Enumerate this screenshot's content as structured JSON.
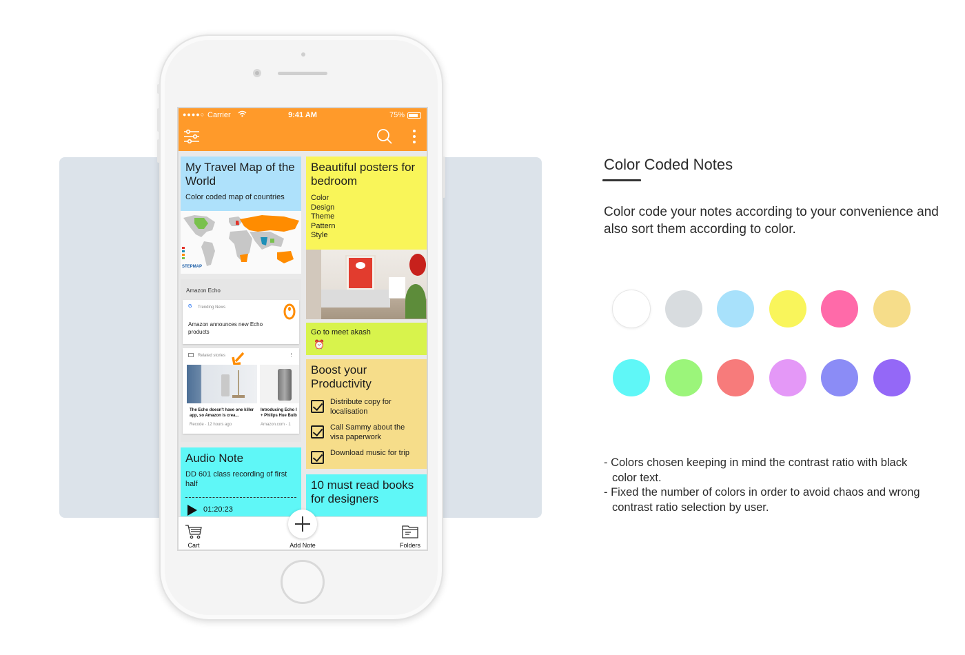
{
  "status_bar": {
    "signal": "●●●●○",
    "carrier": "Carrier",
    "time": "9:41 AM",
    "battery": "75%"
  },
  "app_bar": {
    "filter_icon": "filter-sliders-icon",
    "search_icon": "search-icon",
    "menu_icon": "more-vert-icon"
  },
  "notes": {
    "travel": {
      "title": "My Travel Map of the World",
      "text": "Color coded map of countries",
      "color": "#aee1fb"
    },
    "echo": {
      "label": "Amazon Echo",
      "card1_source": "Trending News",
      "card1_text": "Amazon announces new Echo products",
      "card2_source": "Related stories",
      "story1": "The Echo doesn't have one killer app, so Amazon is crea...",
      "story1_meta": "Recode · 12 hours ago",
      "story2": "Introducing Echo I + Philips Hue Bulb",
      "story2_meta": "Amazon.com · 1"
    },
    "audio": {
      "title": "Audio Note",
      "text": "DD 601 class recording of first half",
      "time": "01:20:23",
      "color": "#5ff7f7"
    },
    "posters": {
      "title": "Beautiful posters for bedroom",
      "items": [
        "Color",
        "Design",
        "Theme",
        "Pattern",
        "Style"
      ],
      "color": "#f9f559"
    },
    "meet": {
      "text": "Go to meet akash",
      "icon": "alarm-clock-icon",
      "color": "#d8f34c"
    },
    "boost": {
      "title": "Boost your Productivity",
      "tasks": [
        "Distribute copy for localisation",
        "Call Sammy about the visa paperwork",
        "Download music for trip"
      ],
      "color": "#f6dd8a"
    },
    "books": {
      "title": "10 must read books for designers",
      "color": "#5ff7f7"
    }
  },
  "tab_bar": {
    "cart": "Cart",
    "add_note": "Add Note",
    "folders": "Folders"
  },
  "info": {
    "heading": "Color Coded Notes",
    "description": "Color code your notes according to your convenience and also sort them according to color.",
    "bullets": [
      "- Colors chosen keeping in mind the contrast ratio with black color text.",
      "- Fixed the number of colors in order to avoid chaos and wrong contrast ratio selection by user."
    ]
  },
  "palette": [
    "#ffffff",
    "#d8dcdf",
    "#a8e1fb",
    "#f9f55b",
    "#ff6aa9",
    "#f6dd8a",
    "#5ff7f7",
    "#9bf57a",
    "#f77b7b",
    "#e498f7",
    "#8b8cf6",
    "#9468f7"
  ]
}
